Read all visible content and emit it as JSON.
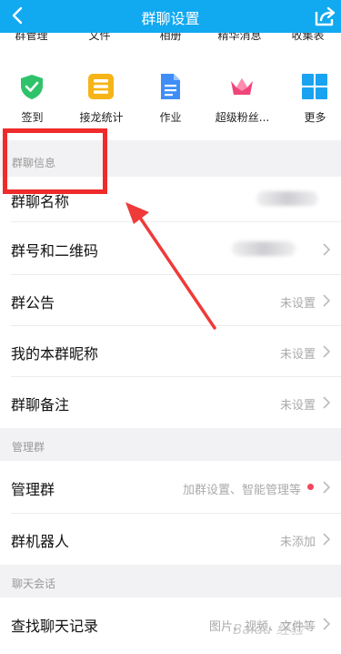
{
  "header": {
    "title": "群聊设置",
    "background_color": "#11a9f0",
    "back_icon": "chevron-left-icon",
    "share_icon": "share-icon"
  },
  "apps_top_row": [
    "群管理",
    "文件",
    "相册",
    "精华消息",
    "收集表"
  ],
  "apps": [
    {
      "label": "签到",
      "icon": "checkin-shield-icon",
      "color": "#2ec36a"
    },
    {
      "label": "接龙统计",
      "icon": "list-icon",
      "color": "#f6b418"
    },
    {
      "label": "作业",
      "icon": "document-icon",
      "color": "#3f8ef7"
    },
    {
      "label": "超级粉丝...",
      "icon": "crown-icon",
      "color": "#f0457a"
    },
    {
      "label": "更多",
      "icon": "grid-icon",
      "color": "#1aa3f0"
    }
  ],
  "sections": {
    "group_info": "群聊信息",
    "manage": "管理群",
    "chat": "聊天会话"
  },
  "rows": {
    "group_name": {
      "label": "群聊名称",
      "value": ""
    },
    "group_number": {
      "label": "群号和二维码",
      "value": ""
    },
    "announcement": {
      "label": "群公告",
      "value": "未设置"
    },
    "my_nickname": {
      "label": "我的本群昵称",
      "value": "未设置"
    },
    "group_remark": {
      "label": "群聊备注",
      "value": "未设置"
    },
    "manage_group": {
      "label": "管理群",
      "value": "加群设置、智能管理等",
      "badge_color": "#f2465b"
    },
    "group_robot": {
      "label": "群机器人",
      "value": "未添加"
    },
    "chat_history": {
      "label": "查找聊天记录",
      "value": "图片、视频、文件等"
    }
  },
  "annotation": {
    "highlight_color": "#ef2b2b"
  },
  "watermark": "Baidu 经验"
}
